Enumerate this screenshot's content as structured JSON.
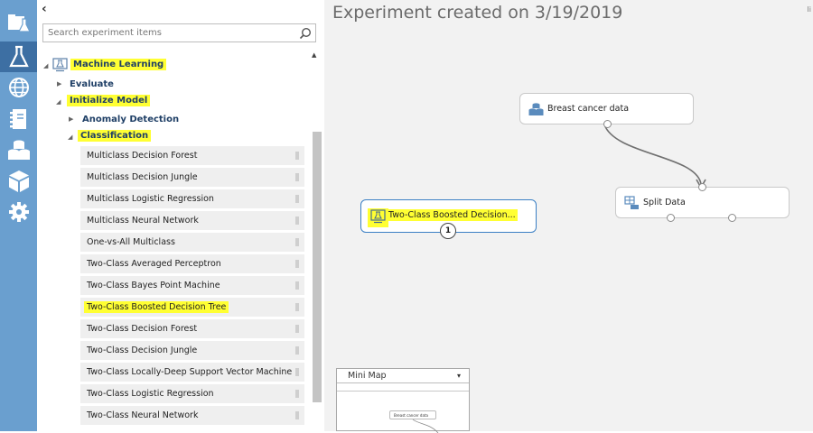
{
  "palette": {
    "collapse_glyph": "‹",
    "search_placeholder": "Search experiment items",
    "tree": {
      "machine_learning": "Machine Learning",
      "evaluate": "Evaluate",
      "initialize_model": "Initialize Model",
      "anomaly_detection": "Anomaly Detection",
      "classification": "Classification"
    },
    "items": [
      "Multiclass Decision Forest",
      "Multiclass Decision Jungle",
      "Multiclass Logistic Regression",
      "Multiclass Neural Network",
      "One-vs-All Multiclass",
      "Two-Class Averaged Perceptron",
      "Two-Class Bayes Point Machine",
      "Two-Class Boosted Decision Tree",
      "Two-Class Decision Forest",
      "Two-Class Decision Jungle",
      "Two-Class Locally-Deep Support Vector Machine",
      "Two-Class Logistic Regression",
      "Two-Class Neural Network"
    ],
    "highlighted_item": "Two-Class Boosted Decision Tree"
  },
  "canvas": {
    "title": "Experiment created on 3/19/2019",
    "corner_glyph": "li",
    "nodes": {
      "breast_cancer": "Breast cancer data",
      "split_data": "Split Data",
      "boosted": "Two-Class Boosted Decision...",
      "boosted_badge": "1"
    },
    "minimap": {
      "title": "Mini Map",
      "node_label": "Breast cancer data"
    }
  },
  "colors": {
    "rail": "#6a9fcf",
    "rail_active": "#3d6fa3",
    "highlight": "#ffff33",
    "selected_border": "#3b7fc4"
  }
}
